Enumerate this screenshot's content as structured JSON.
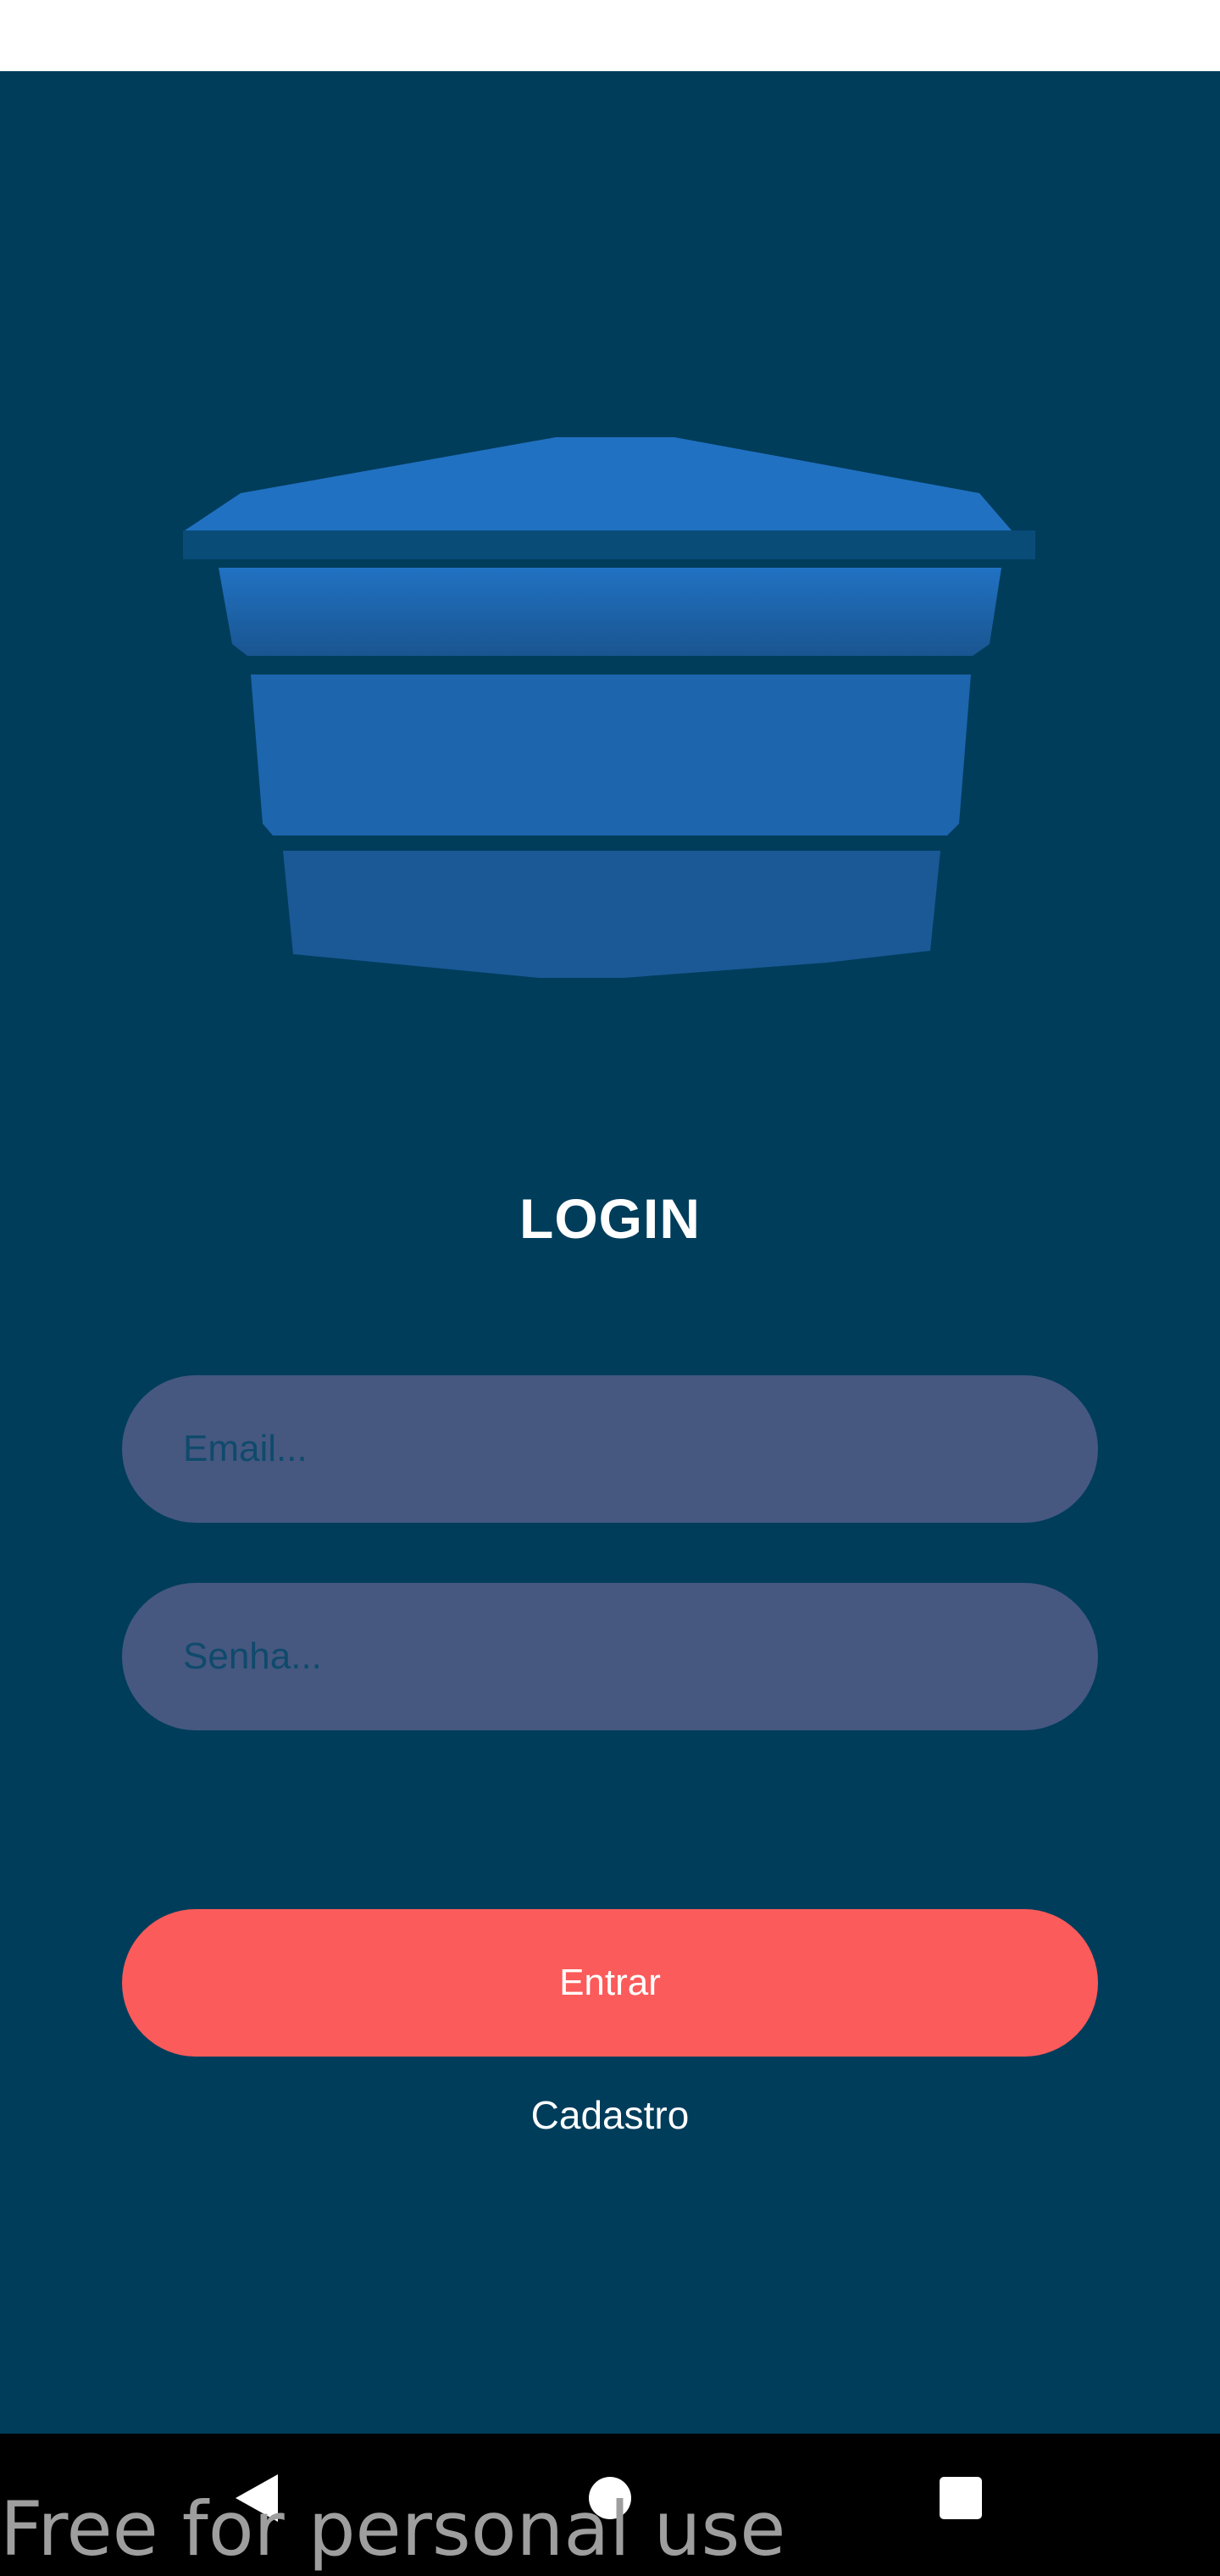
{
  "login": {
    "title": "LOGIN",
    "email": {
      "placeholder": "Email...",
      "value": ""
    },
    "password": {
      "placeholder": "Senha...",
      "value": ""
    },
    "submit_label": "Entrar",
    "register_label": "Cadastro"
  },
  "colors": {
    "background": "#003d5b",
    "input_fill": "#465880",
    "placeholder": "#0f4a6c",
    "button": "#fb5b5a",
    "logo_blue": "#1f6fbf"
  },
  "icons": {
    "logo": "water-tank-icon",
    "nav_back": "triangle-back-icon",
    "nav_home": "circle-home-icon",
    "nav_recents": "square-recents-icon"
  },
  "watermark": "Free for personal use"
}
